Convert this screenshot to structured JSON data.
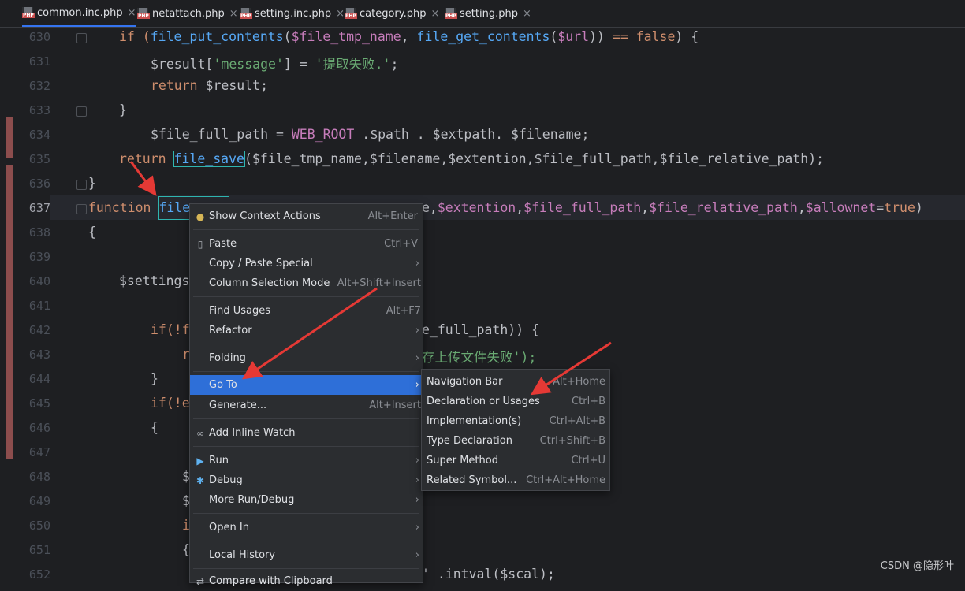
{
  "tabs": [
    {
      "label": "common.inc.php",
      "active": true
    },
    {
      "label": "netattach.php",
      "active": false
    },
    {
      "label": "setting.inc.php",
      "active": false
    },
    {
      "label": "category.php",
      "active": false
    },
    {
      "label": "setting.php",
      "active": false
    }
  ],
  "php_badge": "PHP",
  "close_glyph": "×",
  "line_numbers": [
    "630",
    "631",
    "632",
    "633",
    "634",
    "635",
    "636",
    "637",
    "638",
    "639",
    "640",
    "641",
    "642",
    "643",
    "644",
    "645",
    "646",
    "647",
    "648",
    "649",
    "650",
    "651",
    "652"
  ],
  "code": {
    "l630": [
      "if (",
      "file_put_contents",
      "(",
      "$file_tmp_name",
      ", ",
      "file_get_contents",
      "(",
      "$url",
      ")) ",
      "==",
      " ",
      "false",
      ") {"
    ],
    "l631": [
      "$result",
      "[",
      "'message'",
      "] = ",
      "'提取失败.'",
      ";"
    ],
    "l632": [
      "return ",
      "$result",
      ";"
    ],
    "l633": "}",
    "l634": [
      "$file_full_path",
      " = ",
      "WEB_ROOT",
      " .",
      "$path",
      " . ",
      "$extpath",
      ". ",
      "$filename",
      ";"
    ],
    "l635": [
      "return ",
      "file_save",
      "(",
      "$file_tmp_name",
      ",",
      "$filename",
      ",",
      "$extention",
      ",",
      "$file_full_path",
      ",",
      "$file_relative_path",
      ");"
    ],
    "l636": "}",
    "l637a": [
      "function ",
      "file"
    ],
    "l637b": [
      "e,",
      "$extention",
      ",",
      "$file_full_path",
      ",",
      "$file_relative_path",
      ",",
      "$allownet",
      "=",
      "true",
      ")"
    ],
    "l638": "{",
    "l640": "$settings",
    "l642a": "if(!f",
    "l642b": "e_full_path)) {",
    "l643a": "r",
    "l643b": "存上传文件失败');",
    "l644": "}",
    "l645": "if(!e",
    "l646": "{",
    "l648": "$",
    "l649": "$",
    "l650": "i",
    "l651": "{",
    "l652": "' .intval($scal);"
  },
  "context_menu": [
    {
      "label": "Show Context Actions",
      "shortcut": "Alt+Enter",
      "icon": "bulb-icon"
    },
    {
      "label": "Paste",
      "shortcut": "Ctrl+V",
      "icon": "clipboard-icon"
    },
    {
      "label": "Copy / Paste Special",
      "shortcut": "",
      "submenu": true
    },
    {
      "label": "Column Selection Mode",
      "shortcut": "Alt+Shift+Insert"
    },
    {
      "label": "Find Usages",
      "shortcut": "Alt+F7"
    },
    {
      "label": "Refactor",
      "shortcut": "",
      "submenu": true
    },
    {
      "label": "Folding",
      "shortcut": "",
      "submenu": true
    },
    {
      "label": "Go To",
      "shortcut": "",
      "submenu": true,
      "selected": true
    },
    {
      "label": "Generate...",
      "shortcut": "Alt+Insert"
    },
    {
      "label": "Add Inline Watch",
      "shortcut": "",
      "icon": "watch-icon"
    },
    {
      "label": "Run",
      "shortcut": "",
      "submenu": true,
      "icon": "run-icon"
    },
    {
      "label": "Debug",
      "shortcut": "",
      "submenu": true,
      "icon": "debug-icon"
    },
    {
      "label": "More Run/Debug",
      "shortcut": "",
      "submenu": true
    },
    {
      "label": "Open In",
      "shortcut": "",
      "submenu": true
    },
    {
      "label": "Local History",
      "shortcut": "",
      "submenu": true
    },
    {
      "label": "Compare with Clipboard",
      "shortcut": "",
      "icon": "compare-icon"
    }
  ],
  "goto_submenu": [
    {
      "label": "Navigation Bar",
      "shortcut": "Alt+Home"
    },
    {
      "label": "Declaration or Usages",
      "shortcut": "Ctrl+B"
    },
    {
      "label": "Implementation(s)",
      "shortcut": "Ctrl+Alt+B"
    },
    {
      "label": "Type Declaration",
      "shortcut": "Ctrl+Shift+B"
    },
    {
      "label": "Super Method",
      "shortcut": "Ctrl+U"
    },
    {
      "label": "Related Symbol...",
      "shortcut": "Ctrl+Alt+Home"
    }
  ],
  "submenu_arrow": "›",
  "watermark": "CSDN @隐形叶",
  "colors": {
    "accent": "#2e6fd8",
    "annotation_arrow": "#e53935",
    "highlight_box": "#2fb5b0"
  }
}
